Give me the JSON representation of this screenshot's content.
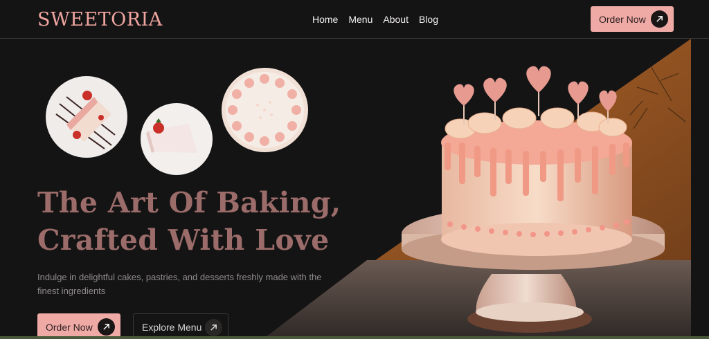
{
  "brand": {
    "name": "SWEETORIA"
  },
  "nav": {
    "items": [
      {
        "label": "Home"
      },
      {
        "label": "Menu"
      },
      {
        "label": "About"
      },
      {
        "label": "Blog"
      }
    ],
    "cta_label": "Order Now"
  },
  "hero": {
    "headline_line1": "The Art Of Baking,",
    "headline_line2": "Crafted With Love",
    "subtitle": "Indulge in delightful cakes, pastries, and desserts freshly made with the finest ingredients",
    "primary_cta": "Order Now",
    "secondary_cta": "Explore Menu"
  },
  "colors": {
    "accent": "#f0aaa6",
    "headline": "#9b6c69",
    "background": "#151415"
  },
  "icons": {
    "cta_arrow": "arrow-up-right-icon"
  }
}
